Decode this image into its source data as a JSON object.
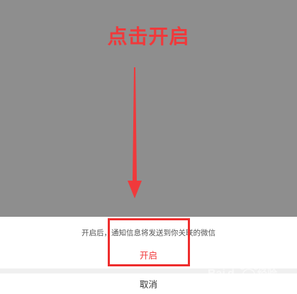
{
  "annotation": {
    "title": "点击开启",
    "color": "#f0393b"
  },
  "sheet": {
    "message": "开启后，通知信息将发送到你关联的微信",
    "enable_label": "开启",
    "cancel_label": "取消"
  },
  "watermark": {
    "brand": "Baidu 经验",
    "icon": "baidu-paw-icon"
  }
}
